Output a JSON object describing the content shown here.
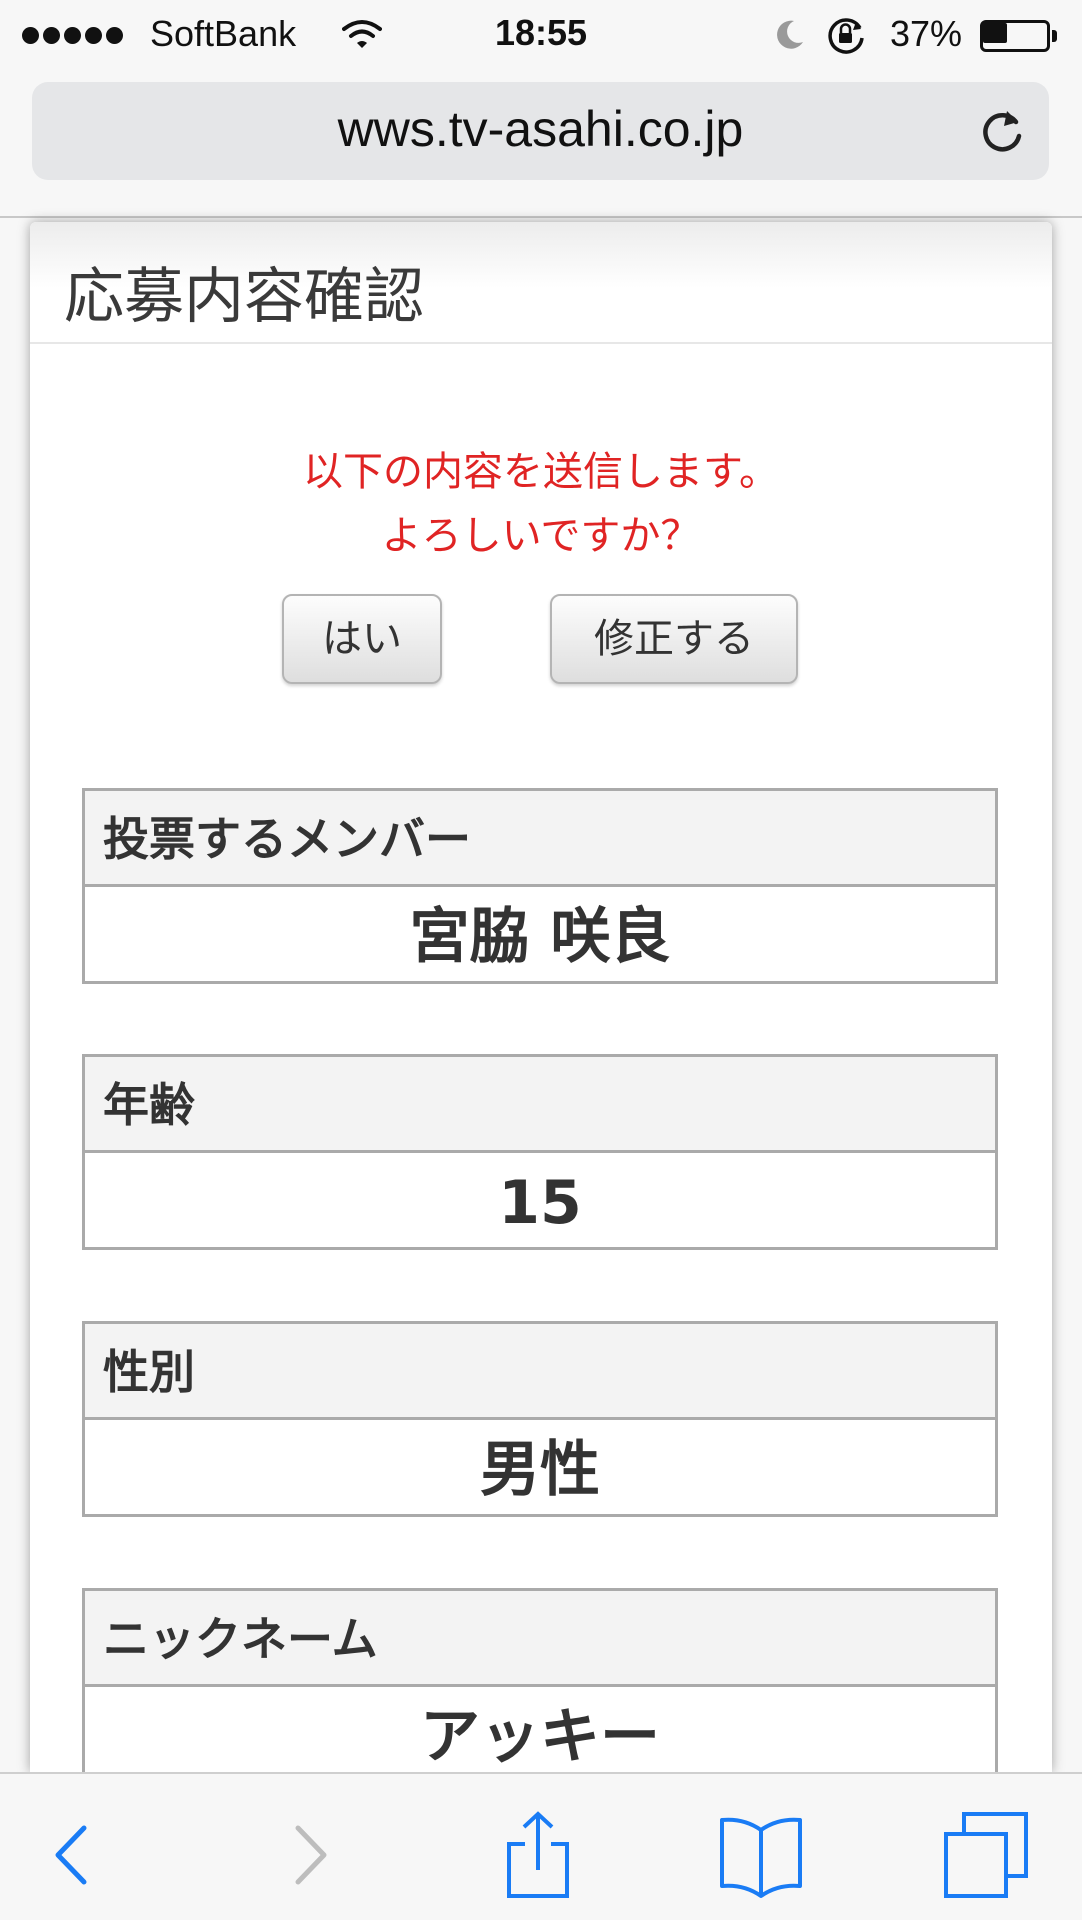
{
  "status_bar": {
    "carrier": "SoftBank",
    "time": "18:55",
    "battery_percent": "37%",
    "battery_level": 0.37
  },
  "browser": {
    "url": "wws.tv-asahi.co.jp"
  },
  "page": {
    "title": "応募内容確認",
    "confirm_line1": "以下の内容を送信します。",
    "confirm_line2": "よろしいですか？",
    "yes_button": "はい",
    "edit_button": "修正する",
    "fields": [
      {
        "label": "投票するメンバー",
        "value": "宮脇 咲良"
      },
      {
        "label": "年齢",
        "value": "15"
      },
      {
        "label": "性別",
        "value": "男性"
      },
      {
        "label": "ニックネーム",
        "value": "アッキー"
      }
    ]
  },
  "colors": {
    "confirm_text": "#e02424",
    "toolbar_active": "#1a7cf5",
    "toolbar_inactive": "#bdbdbd"
  },
  "toolbar_icons": [
    "back-icon",
    "forward-icon",
    "share-icon",
    "bookmarks-icon",
    "tabs-icon"
  ]
}
